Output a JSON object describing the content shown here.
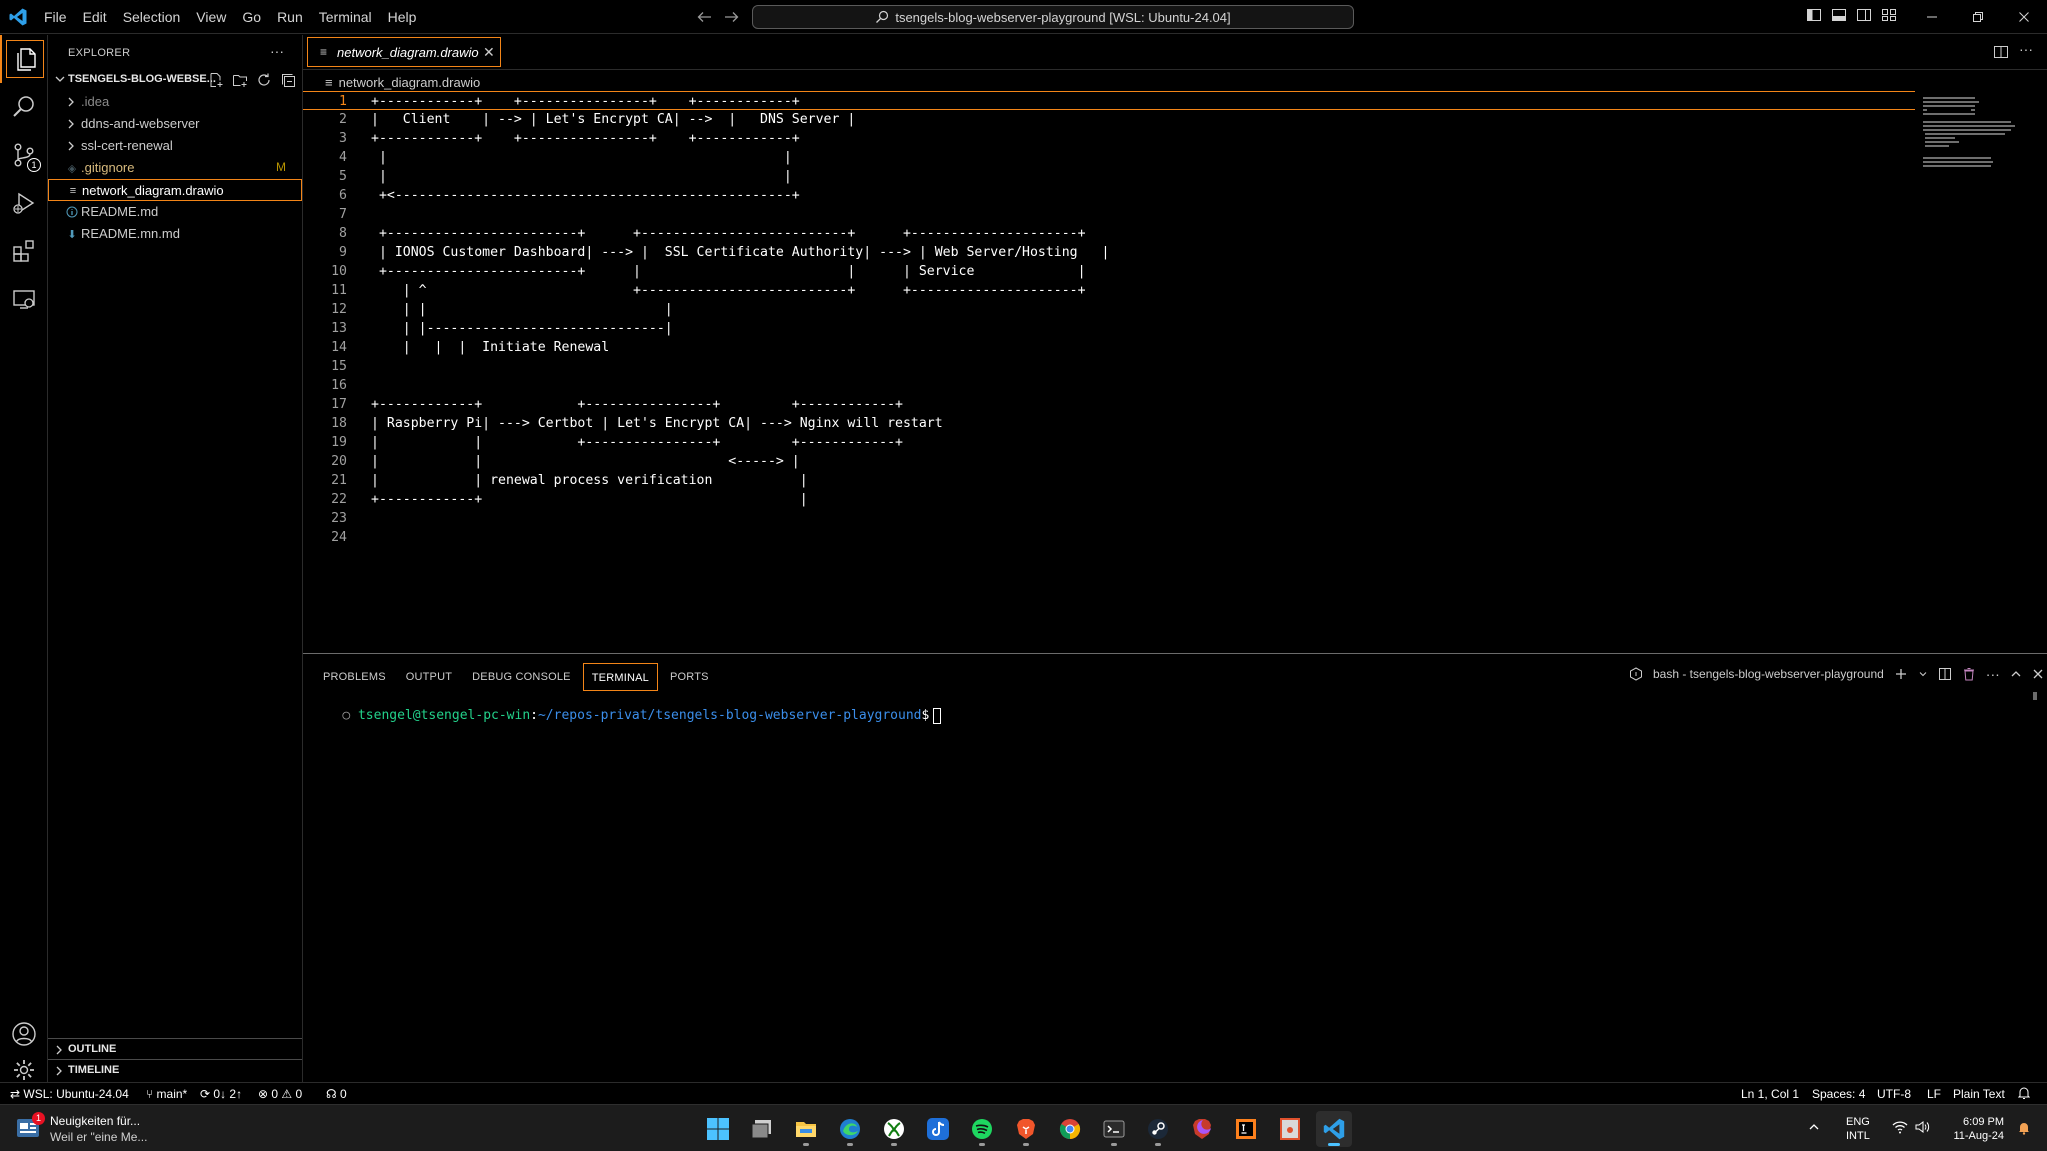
{
  "title_bar": {
    "menu": [
      "File",
      "Edit",
      "Selection",
      "View",
      "Go",
      "Run",
      "Terminal",
      "Help"
    ],
    "command_center": "tsengels-blog-webserver-playground [WSL: Ubuntu-24.04]",
    "window_controls": [
      "minimize",
      "restore",
      "close"
    ]
  },
  "activity_bar": {
    "items": [
      "explorer",
      "search",
      "source-control",
      "run-and-debug",
      "extensions",
      "remote-explorer"
    ],
    "bottom": [
      "accounts",
      "manage"
    ],
    "source_control_badge": "1"
  },
  "sidebar": {
    "title": "EXPLORER",
    "folder": "TSENGELS-BLOG-WEBSE...",
    "items": [
      {
        "label": ".idea",
        "type": "folder"
      },
      {
        "label": "ddns-and-webserver",
        "type": "folder"
      },
      {
        "label": "ssl-cert-renewal",
        "type": "folder"
      },
      {
        "label": ".gitignore",
        "type": "file",
        "badge": "M"
      },
      {
        "label": "network_diagram.drawio",
        "type": "file",
        "selected": true
      },
      {
        "label": "README.md",
        "type": "file"
      },
      {
        "label": "README.mn.md",
        "type": "file"
      }
    ],
    "outline": "OUTLINE",
    "timeline": "TIMELINE"
  },
  "editor": {
    "tab": "network_diagram.drawio",
    "breadcrumb": "network_diagram.drawio",
    "current_line": 1,
    "lines": [
      "+------------+    +----------------+    +------------+",
      "|   Client    | --> | Let's Encrypt CA| -->  |   DNS Server |",
      "+------------+    +----------------+    +------------+",
      " |                                                  |",
      " |                                                  |",
      " +<--------------------------------------------------+",
      "",
      " +------------------------+      +--------------------------+      +---------------------+",
      " | IONOS Customer Dashboard| ---> |  SSL Certificate Authority| ---> | Web Server/Hosting   |",
      " +------------------------+      |                          |      | Service             |",
      "    | ^                          +--------------------------+      +---------------------+",
      "    | |                              |",
      "    | |------------------------------|",
      "    |   |  |  Initiate Renewal",
      "",
      "",
      "+------------+            +----------------+         +------------+",
      "| Raspberry Pi| ---> Certbot | Let's Encrypt CA| ---> Nginx will restart",
      "|            |            +----------------+         +------------+",
      "|            |                               <-----> |",
      "|            | renewal process verification           |",
      "+------------+                                        |",
      "",
      ""
    ]
  },
  "panel": {
    "tabs": [
      "PROBLEMS",
      "OUTPUT",
      "DEBUG CONSOLE",
      "TERMINAL",
      "PORTS"
    ],
    "active_tab": "TERMINAL",
    "terminal_name": "bash - tsengels-blog-webserver-playground",
    "prompt_user": "tsengel@tsengel-pc-win",
    "prompt_sep": ":",
    "prompt_path": "~/repos-privat/tsengels-blog-webserver-playground",
    "prompt_symbol": "$"
  },
  "status_bar": {
    "remote": "WSL: Ubuntu-24.04",
    "branch": "main*",
    "sync": "0↓ 2↑",
    "errors": "0",
    "warnings": "0",
    "ports": "0",
    "position": "Ln 1, Col 1",
    "spaces": "Spaces: 4",
    "encoding": "UTF-8",
    "eol": "LF",
    "language": "Plain Text"
  },
  "taskbar": {
    "news_title": "Neuigkeiten für...",
    "news_sub": "Weil er \"eine Me...",
    "news_badge": "1",
    "apps": [
      "windows-start",
      "task-view",
      "file-explorer",
      "edge-browser",
      "xbox",
      "tiktok",
      "spotify",
      "brave-browser",
      "google-chrome",
      "terminal",
      "steam",
      "brave-nightly",
      "jetbrains-ide",
      "office-app",
      "vscode"
    ],
    "language_top": "ENG",
    "language_bottom": "INTL",
    "time": "6:09 PM",
    "date": "11-Aug-24"
  }
}
